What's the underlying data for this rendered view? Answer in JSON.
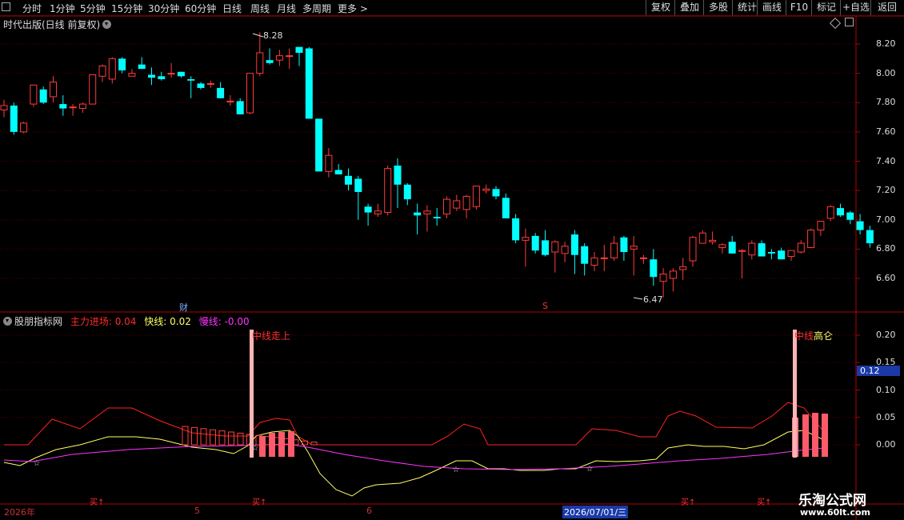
{
  "toolbar": {
    "periods": [
      "分时",
      "1分钟",
      "5分钟",
      "15分钟",
      "30分钟",
      "60分钟",
      "日线",
      "周线",
      "月线",
      "多周期",
      "更多 >"
    ],
    "active": "日线",
    "buttons": [
      "复权",
      "叠加",
      "多股",
      "统计",
      "画线",
      "F10",
      "标记",
      "+自选",
      "返回"
    ]
  },
  "main_panel": {
    "title": "时代出版(日线 前复权)",
    "high_label": "8.28",
    "low_label": "6.47",
    "cai_marker": "财",
    "s_marker": "S",
    "y_ticks": [
      "8.20",
      "8.00",
      "7.80",
      "7.60",
      "7.40",
      "7.20",
      "7.00",
      "6.80",
      "6.60"
    ]
  },
  "indicator_panel": {
    "name": "股朋指标网",
    "zhuli_label": "主力进场:",
    "zhuli_value": "0.04",
    "kuai_label": "快线:",
    "kuai_value": "0.02",
    "man_label": "慢线:",
    "man_value": "-0.00",
    "y_ticks": [
      "0.20",
      "0.15",
      "0.10",
      "0.05",
      "0.00"
    ],
    "current_value_badge": "0.12",
    "annot_left": "中线走上",
    "annot_right_1": "中线",
    "annot_right_2": "高仑",
    "buy_label": "买↑",
    "star_glyph": "☆"
  },
  "x_axis": {
    "labels": [
      "2026年",
      "5",
      "6",
      "2026/07/01/三"
    ]
  },
  "watermark": {
    "title": "乐淘公式网",
    "url": "www.60lt.com"
  },
  "colors": {
    "up": "#ff3b3b",
    "down": "#00ffff",
    "panel_border": "#b00000",
    "kuai": "#ffff66",
    "man": "#ff33ff",
    "zhuli": "#ff2a2a"
  },
  "chart_data": {
    "type": "candlestick",
    "candles": [
      [
        7.75,
        7.82,
        7.7,
        7.78
      ],
      [
        7.78,
        7.8,
        7.58,
        7.6
      ],
      [
        7.6,
        7.67,
        7.59,
        7.66
      ],
      [
        7.79,
        7.92,
        7.77,
        7.92
      ],
      [
        7.89,
        7.91,
        7.79,
        7.8
      ],
      [
        7.84,
        7.98,
        7.8,
        7.94
      ],
      [
        7.79,
        7.85,
        7.71,
        7.76
      ],
      [
        7.77,
        7.79,
        7.71,
        7.77
      ],
      [
        7.76,
        7.8,
        7.73,
        7.79
      ],
      [
        7.79,
        7.98,
        7.79,
        7.99
      ],
      [
        7.98,
        8.06,
        7.94,
        8.05
      ],
      [
        7.96,
        8.11,
        7.93,
        8.1
      ],
      [
        8.1,
        8.11,
        8.0,
        8.02
      ],
      [
        7.98,
        8.03,
        7.98,
        8.0
      ],
      [
        8.06,
        8.11,
        8.03,
        8.03
      ],
      [
        7.99,
        8.04,
        7.92,
        7.97
      ],
      [
        7.98,
        8.01,
        7.95,
        7.96
      ],
      [
        8.0,
        8.07,
        7.97,
        8.0
      ],
      [
        8.01,
        8.01,
        7.97,
        7.98
      ],
      [
        7.96,
        7.98,
        7.83,
        7.95
      ],
      [
        7.93,
        7.94,
        7.89,
        7.9
      ],
      [
        7.93,
        7.95,
        7.9,
        7.93
      ],
      [
        7.9,
        7.94,
        7.83,
        7.83
      ],
      [
        7.81,
        7.85,
        7.78,
        7.81
      ],
      [
        7.81,
        7.83,
        7.72,
        7.72
      ],
      [
        7.73,
        8.0,
        7.72,
        8.0
      ],
      [
        8.0,
        8.28,
        7.98,
        8.14
      ],
      [
        8.09,
        8.17,
        8.06,
        8.07
      ],
      [
        8.09,
        8.16,
        8.05,
        8.12
      ],
      [
        8.12,
        8.17,
        8.03,
        8.12
      ],
      [
        8.18,
        8.18,
        8.05,
        8.14
      ],
      [
        8.17,
        8.18,
        7.71,
        7.69
      ],
      [
        7.69,
        7.55,
        7.33,
        7.33
      ],
      [
        7.33,
        7.49,
        7.29,
        7.44
      ],
      [
        7.34,
        7.38,
        7.32,
        7.31
      ],
      [
        7.3,
        7.35,
        7.2,
        7.24
      ],
      [
        7.28,
        7.3,
        7.0,
        7.19
      ],
      [
        7.09,
        7.11,
        6.96,
        7.05
      ],
      [
        7.04,
        7.11,
        7.02,
        7.06
      ],
      [
        7.05,
        7.37,
        7.03,
        7.35
      ],
      [
        7.37,
        7.42,
        7.08,
        7.24
      ],
      [
        7.24,
        7.25,
        7.1,
        7.14
      ],
      [
        7.05,
        7.11,
        6.9,
        7.03
      ],
      [
        7.04,
        7.1,
        6.92,
        7.06
      ],
      [
        7.02,
        7.08,
        6.96,
        7.01
      ],
      [
        7.04,
        7.16,
        7.01,
        7.14
      ],
      [
        7.08,
        7.17,
        7.06,
        7.13
      ],
      [
        7.07,
        7.17,
        7.01,
        7.16
      ],
      [
        7.09,
        7.23,
        7.07,
        7.23
      ],
      [
        7.2,
        7.24,
        7.18,
        7.21
      ],
      [
        7.21,
        7.23,
        7.14,
        7.16
      ],
      [
        7.15,
        7.18,
        7.01,
        7.01
      ],
      [
        7.01,
        7.04,
        6.84,
        6.86
      ],
      [
        6.86,
        6.94,
        6.68,
        6.88
      ],
      [
        6.89,
        6.91,
        6.77,
        6.79
      ],
      [
        6.86,
        6.93,
        6.75,
        6.76
      ],
      [
        6.78,
        6.86,
        6.64,
        6.85
      ],
      [
        6.77,
        6.85,
        6.71,
        6.82
      ],
      [
        6.9,
        6.93,
        6.63,
        6.76
      ],
      [
        6.82,
        6.84,
        6.62,
        6.7
      ],
      [
        6.69,
        6.78,
        6.65,
        6.74
      ],
      [
        6.74,
        6.83,
        6.65,
        6.74
      ],
      [
        6.74,
        6.89,
        6.72,
        6.84
      ],
      [
        6.88,
        6.89,
        6.72,
        6.78
      ],
      [
        6.8,
        6.89,
        6.62,
        6.82
      ],
      [
        6.74,
        6.76,
        6.7,
        6.74
      ],
      [
        6.73,
        6.8,
        6.55,
        6.61
      ],
      [
        6.58,
        6.67,
        6.47,
        6.63
      ],
      [
        6.6,
        6.67,
        6.51,
        6.65
      ],
      [
        6.66,
        6.74,
        6.59,
        6.68
      ],
      [
        6.72,
        6.89,
        6.68,
        6.88
      ],
      [
        6.84,
        6.93,
        6.85,
        6.91
      ],
      [
        6.85,
        6.92,
        6.83,
        6.86
      ],
      [
        6.81,
        6.84,
        6.77,
        6.83
      ],
      [
        6.85,
        6.89,
        6.77,
        6.77
      ],
      [
        6.79,
        6.8,
        6.6,
        6.79
      ],
      [
        6.76,
        6.86,
        6.73,
        6.84
      ],
      [
        6.84,
        6.86,
        6.75,
        6.75
      ],
      [
        6.78,
        6.8,
        6.73,
        6.77
      ],
      [
        6.79,
        6.81,
        6.76,
        6.73
      ],
      [
        6.75,
        6.79,
        6.72,
        6.79
      ],
      [
        6.78,
        6.86,
        6.77,
        6.84
      ],
      [
        6.81,
        6.94,
        6.81,
        6.93
      ],
      [
        6.93,
        6.93,
        6.89,
        6.99
      ],
      [
        7.01,
        7.1,
        6.99,
        7.09
      ],
      [
        7.08,
        7.11,
        7.02,
        7.03
      ],
      [
        7.05,
        7.06,
        6.97,
        7.0
      ],
      [
        6.99,
        7.04,
        6.9,
        6.93
      ],
      [
        6.93,
        6.96,
        6.81,
        6.84
      ]
    ],
    "buy_signals": [
      {
        "x": "5",
        "label": "买↑"
      },
      {
        "x": "2026年",
        "label": "买↑"
      }
    ]
  }
}
